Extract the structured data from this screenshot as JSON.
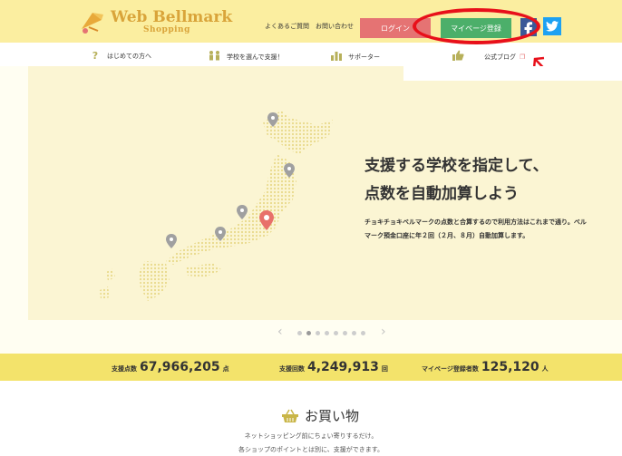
{
  "header": {
    "logo_title": "Web Bellmark",
    "logo_sub": "Shopping",
    "faq_link": "よくあるご質問",
    "contact_link": "お問い合わせ",
    "login_label": "ログイン",
    "mypage_label": "マイページ登録"
  },
  "nav": {
    "items": [
      {
        "label": "はじめての方へ",
        "icon": "question-icon"
      },
      {
        "label": "学校を選んで支援！",
        "icon": "people-icon"
      },
      {
        "label": "サポーター",
        "icon": "bar-chart-icon"
      },
      {
        "label": "公式ブログ",
        "icon": "thumbs-up-icon"
      }
    ]
  },
  "hero": {
    "title_line1": "支援する学校を指定して、",
    "title_line2": "点数を自動加算しよう",
    "desc": "チョキチョキベルマークの点数と合算するので利用方法はこれまで通り。ベルマーク預金口座に年２回（２月、８月）自動加算します。",
    "slide_count": 8,
    "active_slide": 2
  },
  "stats": {
    "support_points_label": "支援点数",
    "support_points_value": "67,966,205",
    "support_points_unit": "点",
    "support_count_label": "支援回数",
    "support_count_value": "4,249,913",
    "support_count_unit": "回",
    "mypage_count_label": "マイページ登録者数",
    "mypage_count_value": "125,120",
    "mypage_count_unit": "人"
  },
  "shopping": {
    "title": "お買い物",
    "line1": "ネットショッピング前にちょい寄りするだけ。",
    "line2": "各ショップのポイントとは別に、支援ができます。"
  },
  "colors": {
    "header_bg": "#fbeea0",
    "login": "#e57373",
    "mypage": "#4caf6a",
    "facebook": "#3b5998",
    "twitter": "#1da1f2",
    "stats_bg": "#f3e36b",
    "annotation": "#e8101a"
  }
}
